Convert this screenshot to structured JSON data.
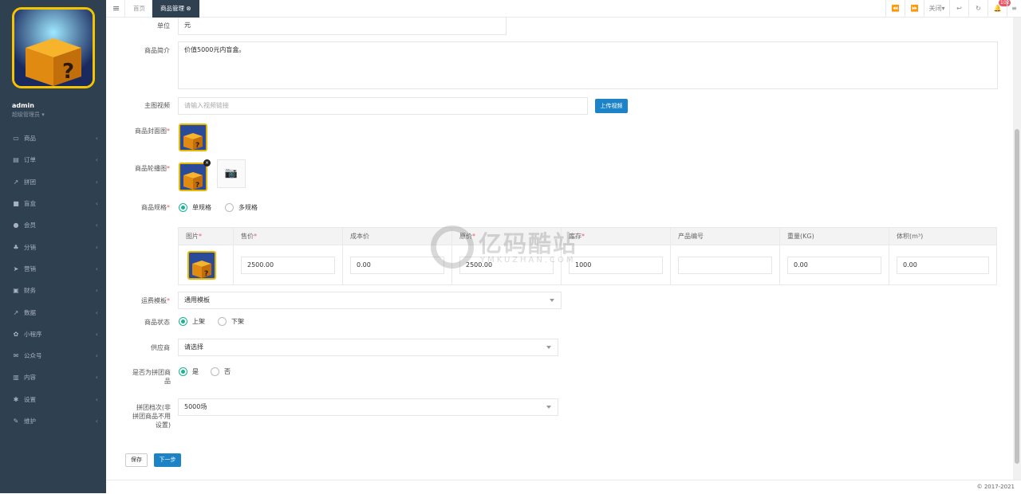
{
  "user": {
    "name": "admin",
    "role": "超级管理员 ▾"
  },
  "menu": [
    {
      "icon": "▭",
      "label": "商品"
    },
    {
      "icon": "▤",
      "label": "订单"
    },
    {
      "icon": "↗",
      "label": "拼团"
    },
    {
      "icon": "■",
      "label": "盲盒"
    },
    {
      "icon": "●",
      "label": "会员"
    },
    {
      "icon": "♣",
      "label": "分销"
    },
    {
      "icon": "➤",
      "label": "营销"
    },
    {
      "icon": "▣",
      "label": "财务"
    },
    {
      "icon": "↗",
      "label": "数据"
    },
    {
      "icon": "✿",
      "label": "小程序"
    },
    {
      "icon": "✉",
      "label": "公众号"
    },
    {
      "icon": "▥",
      "label": "内容"
    },
    {
      "icon": "✱",
      "label": "设置"
    },
    {
      "icon": "✎",
      "label": "维护"
    }
  ],
  "topbar": {
    "tabs": [
      {
        "label": "首页"
      },
      {
        "label": "商品管理 ⊗"
      }
    ],
    "close_label": "关闭▾",
    "badge": "102"
  },
  "form": {
    "unit_label": "单位",
    "unit_value": "元",
    "intro_label": "商品简介",
    "intro_value": "价值5000元内盲盒。",
    "video_label": "主图视频",
    "video_placeholder": "请输入视频链接",
    "upload_video": "上传视频",
    "cover_label": "商品封面图",
    "carousel_label": "商品轮播图",
    "spec_label": "商品规格",
    "spec_options": [
      "单规格",
      "多规格"
    ],
    "spec_table": {
      "headers": [
        "图片",
        "售价",
        "成本价",
        "原价",
        "库存",
        "产品编号",
        "重量(KG)",
        "体积(m³)"
      ],
      "required": [
        true,
        true,
        false,
        true,
        true,
        false,
        false,
        false
      ],
      "row": [
        "2500.00",
        "0.00",
        "2500.00",
        "1000",
        "",
        "0.00",
        "0.00"
      ]
    },
    "shipping_label": "运费模板",
    "shipping_value": "通用模板",
    "status_label": "商品状态",
    "status_options": [
      "上架",
      "下架"
    ],
    "supplier_label": "供应商",
    "supplier_value": "请选择",
    "group_label": "是否为拼团商品",
    "group_options": [
      "是",
      "否"
    ],
    "group_times_label": "拼团档次(非拼团商品不用设置)",
    "group_times_value": "5000场",
    "save": "保存",
    "next": "下一步"
  },
  "watermark": {
    "title": "亿码酷站",
    "sub": "YMKUZHAN.COM"
  },
  "footer": "© 2017-2021",
  "colors": {
    "sidebar": "#2f4050",
    "primary": "#1c84c6",
    "radio": "#1ab394",
    "required": "#ed5565"
  }
}
